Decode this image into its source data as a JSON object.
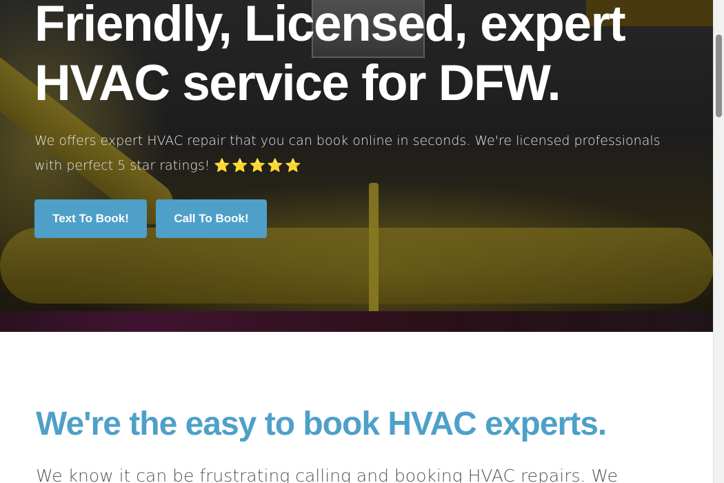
{
  "hero": {
    "title": "Friendly, Licensed, expert HVAC service for DFW.",
    "subtitle": "We offers expert HVAC repair that you can book online in seconds. We're licensed professionals with perfect 5 star ratings!",
    "stars": "⭐⭐⭐⭐⭐",
    "buttons": {
      "text_to_book": "Text To Book!",
      "call_to_book": "Call To Book!"
    }
  },
  "section": {
    "title": "We're the easy to book HVAC experts.",
    "body": "We know it can be frustrating calling and booking HVAC repairs. We"
  },
  "colors": {
    "accent": "#4ea0c8",
    "hero_text": "#ffffff"
  }
}
